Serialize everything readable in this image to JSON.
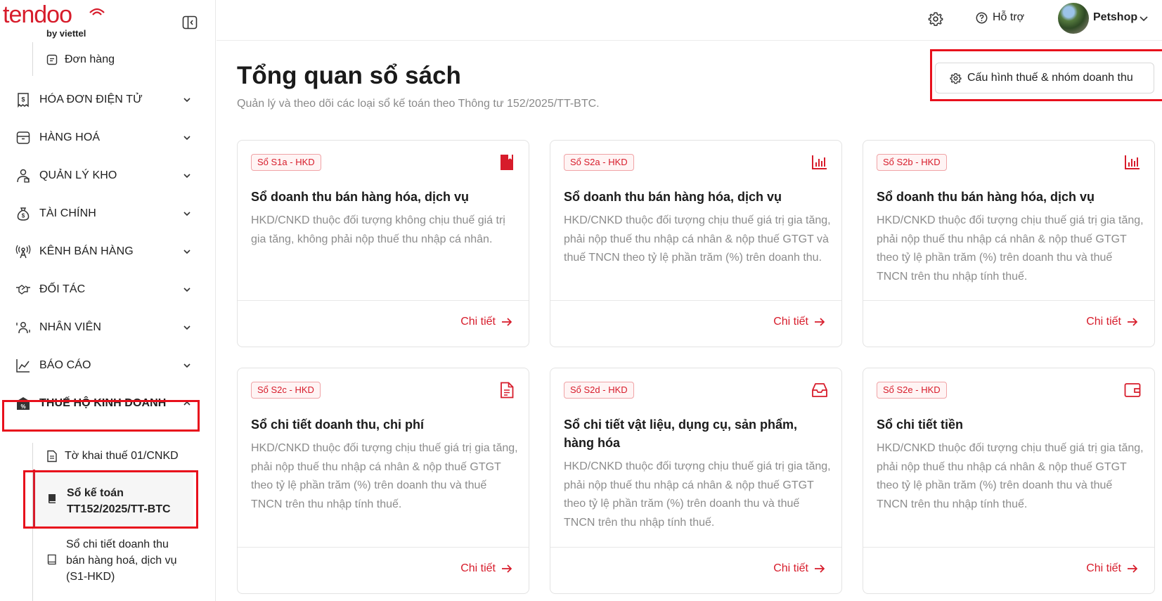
{
  "brand": {
    "name": "tendoo",
    "sub": "by viettel",
    "color": "#d71c2b"
  },
  "sidebar": {
    "top_sub_item": {
      "label": "Đơn hàng",
      "icon": "order-icon"
    },
    "items": [
      {
        "label": "HÓA ĐƠN ĐIỆN TỬ",
        "icon": "invoice-icon"
      },
      {
        "label": "HÀNG HOÁ",
        "icon": "box-icon"
      },
      {
        "label": "QUẢN LÝ KHO",
        "icon": "warehouse-icon"
      },
      {
        "label": "TÀI CHÍNH",
        "icon": "money-bag-icon"
      },
      {
        "label": "KÊNH BÁN HÀNG",
        "icon": "antenna-icon"
      },
      {
        "label": "ĐỐI TÁC",
        "icon": "handshake-icon"
      },
      {
        "label": "NHÂN VIÊN",
        "icon": "staff-icon"
      },
      {
        "label": "BÁO CÁO",
        "icon": "chart-line-icon"
      },
      {
        "label": "THUẾ HỘ KINH DOANH",
        "icon": "tax-building-icon"
      }
    ],
    "tax_sub_items": [
      {
        "label": "Tờ khai thuế 01/CNKD",
        "icon": "document-icon"
      },
      {
        "label_line1": "Sổ kế toán",
        "label_line2": "TT152/2025/TT-BTC",
        "icon": "book-icon",
        "active": true
      },
      {
        "label_line1": "Sổ chi tiết doanh thu",
        "label_line2": "bán hàng hoá, dịch vụ",
        "label_line3": "(S1-HKD)",
        "icon": "book-outline-icon"
      }
    ]
  },
  "header": {
    "settings_icon": "gear-icon",
    "help_label": "Hỗ trợ",
    "user_name": "Petshop"
  },
  "main": {
    "title": "Tổng quan sổ sách",
    "subtitle": "Quản lý và theo dõi các loại sổ kế toán theo Thông tư 152/2025/TT-BTC.",
    "config_button": "Cấu hình thuế & nhóm doanh thu",
    "detail_label": "Chi tiết",
    "cards": [
      {
        "badge": "Sổ S1a - HKD",
        "icon": "bookmark-icon",
        "title": "Sổ doanh thu bán hàng hóa, dịch vụ",
        "desc": "HKD/CNKD thuộc đối tượng không chịu thuế giá trị gia tăng, không phải nộp thuế thu nhập cá nhân."
      },
      {
        "badge": "Sổ S2a - HKD",
        "icon": "bar-chart-icon",
        "title": "Sổ doanh thu bán hàng hóa, dịch vụ",
        "desc": "HKD/CNKD thuộc đối tượng chịu thuế giá trị gia tăng, phải nộp thuế thu nhập cá nhân & nộp thuế GTGT và thuế TNCN theo tỷ lệ phần trăm (%) trên doanh thu."
      },
      {
        "badge": "Sổ S2b - HKD",
        "icon": "bar-chart-icon",
        "title": "Sổ doanh thu bán hàng hóa, dịch vụ",
        "desc": "HKD/CNKD thuộc đối tượng chịu thuế giá trị gia tăng, phải nộp thuế thu nhập cá nhân & nộp thuế GTGT theo tỷ lệ phần trăm (%) trên doanh thu và thuế TNCN trên thu nhập tính thuế."
      },
      {
        "badge": "Sổ S2c - HKD",
        "icon": "file-text-icon",
        "title": "Sổ chi tiết doanh thu, chi phí",
        "desc": "HKD/CNKD thuộc đối tượng chịu thuế giá trị gia tăng, phải nộp thuế thu nhập cá nhân & nộp thuế GTGT theo tỷ lệ phần trăm (%) trên doanh thu và thuế TNCN trên thu nhập tính thuế."
      },
      {
        "badge": "Sổ S2d - HKD",
        "icon": "inbox-icon",
        "title": "Sổ chi tiết vật liệu, dụng cụ, sản phẩm, hàng hóa",
        "desc": "HKD/CNKD thuộc đối tượng chịu thuế giá trị gia tăng, phải nộp thuế thu nhập cá nhân & nộp thuế GTGT theo tỷ lệ phần trăm (%) trên doanh thu và thuế TNCN trên thu nhập tính thuế."
      },
      {
        "badge": "Sổ S2e - HKD",
        "icon": "wallet-icon",
        "title": "Sổ chi tiết tiền",
        "desc": "HKD/CNKD thuộc đối tượng chịu thuế giá trị gia tăng, phải nộp thuế thu nhập cá nhân & nộp thuế GTGT theo tỷ lệ phần trăm (%) trên doanh thu và thuế TNCN trên thu nhập tính thuế."
      }
    ]
  }
}
